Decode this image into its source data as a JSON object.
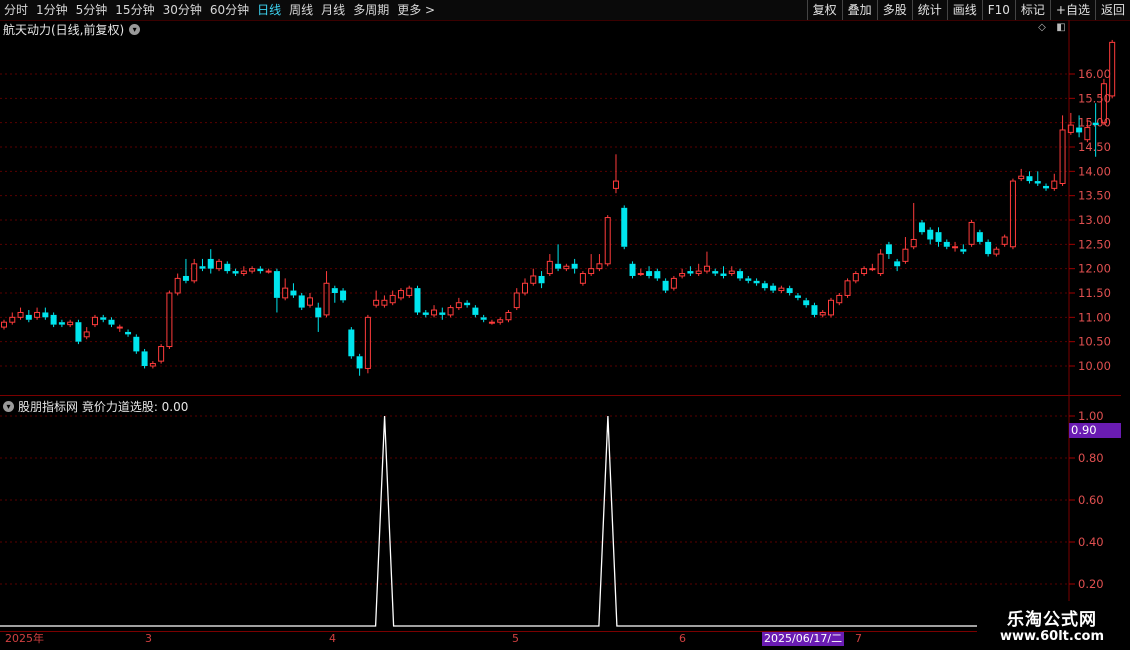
{
  "toolbar": {
    "periods": [
      "分时",
      "1分钟",
      "5分钟",
      "15分钟",
      "30分钟",
      "60分钟",
      "日线",
      "周线",
      "月线",
      "多周期",
      "更多 >"
    ],
    "active_period": "日线",
    "right_buttons": [
      "复权",
      "叠加",
      "多股",
      "统计",
      "画线",
      "F10",
      "标记",
      "+自选",
      "返回"
    ]
  },
  "main_chart": {
    "title": "航天动力(日线,前复权)",
    "price_axis": [
      "16.00",
      "15.50",
      "15.00",
      "14.50",
      "14.00",
      "13.50",
      "13.00",
      "12.50",
      "12.00",
      "11.50",
      "11.00",
      "10.50",
      "10.00"
    ]
  },
  "indicator": {
    "title": "股朋指标网 竟价力道选股: 0.00",
    "axis": [
      "1.00",
      "0.80",
      "0.60",
      "0.40",
      "0.20"
    ],
    "highlight_value": "0.90"
  },
  "date_axis": {
    "labels": [
      "2025年",
      "3",
      "4",
      "5",
      "6",
      "7"
    ],
    "selected_date": "2025/06/17/二"
  },
  "watermark": {
    "line1": "乐淘公式网",
    "line2": "www.60lt.com"
  },
  "chart_data": {
    "type": "candlestick",
    "title": "航天动力(日线,前复权)",
    "up_color": "#ff3c3c",
    "down_color": "#00e5ee",
    "ylim": [
      9.75,
      16.65
    ],
    "candles": [
      [
        10.8,
        10.9,
        10.75,
        10.95
      ],
      [
        10.9,
        11.0,
        10.85,
        11.1
      ],
      [
        11.0,
        11.1,
        10.95,
        11.2
      ],
      [
        11.05,
        10.95,
        10.9,
        11.15
      ],
      [
        11.0,
        11.1,
        10.95,
        11.2
      ],
      [
        11.1,
        11.0,
        10.95,
        11.2
      ],
      [
        11.05,
        10.85,
        10.8,
        11.1
      ],
      [
        10.9,
        10.85,
        10.8,
        10.95
      ],
      [
        10.85,
        10.9,
        10.8,
        10.95
      ],
      [
        10.9,
        10.5,
        10.45,
        10.95
      ],
      [
        10.6,
        10.7,
        10.55,
        10.8
      ],
      [
        10.85,
        11.0,
        10.8,
        11.05
      ],
      [
        11.0,
        10.95,
        10.9,
        11.05
      ],
      [
        10.95,
        10.85,
        10.8,
        11.0
      ],
      [
        10.8,
        10.8,
        10.7,
        10.85
      ],
      [
        10.7,
        10.65,
        10.6,
        10.75
      ],
      [
        10.6,
        10.3,
        10.25,
        10.65
      ],
      [
        10.3,
        10.0,
        9.95,
        10.35
      ],
      [
        10.0,
        10.05,
        9.95,
        10.1
      ],
      [
        10.1,
        10.4,
        10.05,
        10.45
      ],
      [
        10.4,
        11.5,
        10.35,
        11.55
      ],
      [
        11.5,
        11.8,
        11.45,
        11.9
      ],
      [
        11.85,
        11.75,
        11.7,
        12.2
      ],
      [
        11.75,
        12.1,
        11.7,
        12.2
      ],
      [
        12.05,
        12.0,
        11.95,
        12.2
      ],
      [
        12.2,
        12.0,
        11.9,
        12.4
      ],
      [
        12.0,
        12.15,
        11.95,
        12.2
      ],
      [
        12.1,
        11.95,
        11.9,
        12.15
      ],
      [
        11.95,
        11.9,
        11.85,
        12.0
      ],
      [
        11.9,
        11.95,
        11.85,
        12.05
      ],
      [
        11.95,
        12.0,
        11.9,
        12.05
      ],
      [
        12.0,
        11.95,
        11.9,
        12.05
      ],
      [
        11.95,
        11.95,
        11.9,
        12.0
      ],
      [
        11.95,
        11.4,
        11.1,
        12.0
      ],
      [
        11.4,
        11.6,
        11.35,
        11.8
      ],
      [
        11.55,
        11.45,
        11.4,
        11.7
      ],
      [
        11.45,
        11.2,
        11.15,
        11.5
      ],
      [
        11.25,
        11.4,
        11.2,
        11.5
      ],
      [
        11.2,
        11.0,
        10.7,
        11.3
      ],
      [
        11.05,
        11.7,
        11.0,
        11.95
      ],
      [
        11.6,
        11.5,
        11.3,
        11.65
      ],
      [
        11.55,
        11.35,
        11.3,
        11.6
      ],
      [
        10.75,
        10.2,
        10.15,
        10.8
      ],
      [
        10.2,
        9.95,
        9.8,
        10.25
      ],
      [
        9.95,
        11.0,
        9.85,
        11.05
      ],
      [
        11.25,
        11.35,
        11.2,
        11.55
      ],
      [
        11.25,
        11.35,
        11.2,
        11.45
      ],
      [
        11.3,
        11.45,
        11.25,
        11.55
      ],
      [
        11.4,
        11.55,
        11.35,
        11.6
      ],
      [
        11.45,
        11.6,
        11.4,
        11.65
      ],
      [
        11.6,
        11.1,
        11.05,
        11.65
      ],
      [
        11.1,
        11.05,
        11.0,
        11.15
      ],
      [
        11.05,
        11.15,
        11.0,
        11.25
      ],
      [
        11.1,
        11.05,
        10.95,
        11.2
      ],
      [
        11.05,
        11.2,
        11.0,
        11.25
      ],
      [
        11.2,
        11.3,
        11.15,
        11.4
      ],
      [
        11.3,
        11.25,
        11.2,
        11.35
      ],
      [
        11.2,
        11.05,
        11.0,
        11.25
      ],
      [
        11.0,
        10.95,
        10.9,
        11.05
      ],
      [
        10.9,
        10.9,
        10.85,
        10.95
      ],
      [
        10.9,
        10.95,
        10.85,
        11.0
      ],
      [
        10.95,
        11.1,
        10.9,
        11.15
      ],
      [
        11.2,
        11.5,
        11.15,
        11.6
      ],
      [
        11.5,
        11.7,
        11.45,
        11.8
      ],
      [
        11.7,
        11.85,
        11.65,
        12.0
      ],
      [
        11.85,
        11.7,
        11.6,
        11.95
      ],
      [
        11.9,
        12.15,
        11.85,
        12.3
      ],
      [
        12.1,
        12.0,
        11.95,
        12.5
      ],
      [
        12.0,
        12.05,
        11.95,
        12.1
      ],
      [
        12.1,
        12.0,
        11.9,
        12.2
      ],
      [
        11.7,
        11.9,
        11.65,
        11.95
      ],
      [
        11.9,
        12.0,
        11.85,
        12.3
      ],
      [
        12.0,
        12.1,
        11.95,
        12.3
      ],
      [
        12.1,
        13.05,
        12.05,
        13.1
      ],
      [
        13.65,
        13.8,
        13.55,
        14.35
      ],
      [
        13.25,
        12.45,
        12.4,
        13.3
      ],
      [
        12.1,
        11.85,
        11.8,
        12.15
      ],
      [
        11.9,
        11.9,
        11.85,
        12.0
      ],
      [
        11.95,
        11.85,
        11.8,
        12.05
      ],
      [
        11.95,
        11.8,
        11.75,
        12.0
      ],
      [
        11.75,
        11.55,
        11.5,
        11.8
      ],
      [
        11.6,
        11.8,
        11.55,
        11.85
      ],
      [
        11.85,
        11.9,
        11.8,
        12.0
      ],
      [
        11.95,
        11.9,
        11.85,
        12.05
      ],
      [
        11.9,
        11.95,
        11.85,
        12.1
      ],
      [
        11.95,
        12.05,
        11.9,
        12.35
      ],
      [
        11.95,
        11.9,
        11.85,
        12.0
      ],
      [
        11.9,
        11.85,
        11.8,
        12.05
      ],
      [
        11.9,
        11.95,
        11.85,
        12.05
      ],
      [
        11.95,
        11.8,
        11.75,
        12.0
      ],
      [
        11.8,
        11.75,
        11.7,
        11.85
      ],
      [
        11.75,
        11.7,
        11.65,
        11.8
      ],
      [
        11.7,
        11.6,
        11.55,
        11.75
      ],
      [
        11.65,
        11.55,
        11.5,
        11.7
      ],
      [
        11.55,
        11.6,
        11.5,
        11.65
      ],
      [
        11.6,
        11.5,
        11.45,
        11.65
      ],
      [
        11.45,
        11.4,
        11.35,
        11.5
      ],
      [
        11.35,
        11.25,
        11.2,
        11.4
      ],
      [
        11.25,
        11.05,
        11.0,
        11.3
      ],
      [
        11.05,
        11.1,
        11.0,
        11.15
      ],
      [
        11.05,
        11.35,
        11.0,
        11.4
      ],
      [
        11.3,
        11.45,
        11.25,
        11.5
      ],
      [
        11.45,
        11.75,
        11.4,
        11.8
      ],
      [
        11.75,
        11.9,
        11.7,
        11.95
      ],
      [
        11.9,
        12.0,
        11.85,
        12.05
      ],
      [
        12.0,
        12.0,
        11.95,
        12.1
      ],
      [
        11.9,
        12.3,
        11.85,
        12.4
      ],
      [
        12.5,
        12.3,
        12.2,
        12.55
      ],
      [
        12.15,
        12.05,
        11.95,
        12.2
      ],
      [
        12.15,
        12.4,
        12.1,
        12.65
      ],
      [
        12.45,
        12.6,
        12.4,
        13.35
      ],
      [
        12.95,
        12.75,
        12.7,
        13.0
      ],
      [
        12.8,
        12.6,
        12.5,
        12.85
      ],
      [
        12.75,
        12.55,
        12.45,
        12.85
      ],
      [
        12.55,
        12.45,
        12.4,
        12.6
      ],
      [
        12.45,
        12.45,
        12.35,
        12.55
      ],
      [
        12.4,
        12.35,
        12.3,
        12.5
      ],
      [
        12.5,
        12.95,
        12.45,
        13.0
      ],
      [
        12.75,
        12.55,
        12.5,
        12.8
      ],
      [
        12.55,
        12.3,
        12.25,
        12.6
      ],
      [
        12.3,
        12.4,
        12.25,
        12.45
      ],
      [
        12.5,
        12.65,
        12.45,
        12.7
      ],
      [
        12.45,
        13.8,
        12.4,
        13.85
      ],
      [
        13.85,
        13.9,
        13.8,
        14.05
      ],
      [
        13.9,
        13.8,
        13.75,
        14.0
      ],
      [
        13.8,
        13.75,
        13.7,
        14.0
      ],
      [
        13.7,
        13.65,
        13.6,
        13.75
      ],
      [
        13.65,
        13.8,
        13.6,
        13.95
      ],
      [
        13.75,
        14.85,
        13.7,
        15.15
      ],
      [
        14.8,
        14.95,
        14.75,
        15.2
      ],
      [
        14.9,
        14.8,
        14.7,
        15.15
      ],
      [
        14.65,
        14.9,
        14.6,
        15.05
      ],
      [
        15.0,
        14.95,
        14.3,
        15.4
      ],
      [
        15.0,
        15.8,
        14.95,
        15.9
      ],
      [
        15.55,
        16.65,
        15.5,
        16.7
      ]
    ],
    "indicator": {
      "ylim": [
        0,
        1.0
      ],
      "spikes": [
        {
          "candle": 46,
          "value": 1.0
        },
        {
          "candle": 73,
          "value": 1.0
        }
      ]
    }
  }
}
